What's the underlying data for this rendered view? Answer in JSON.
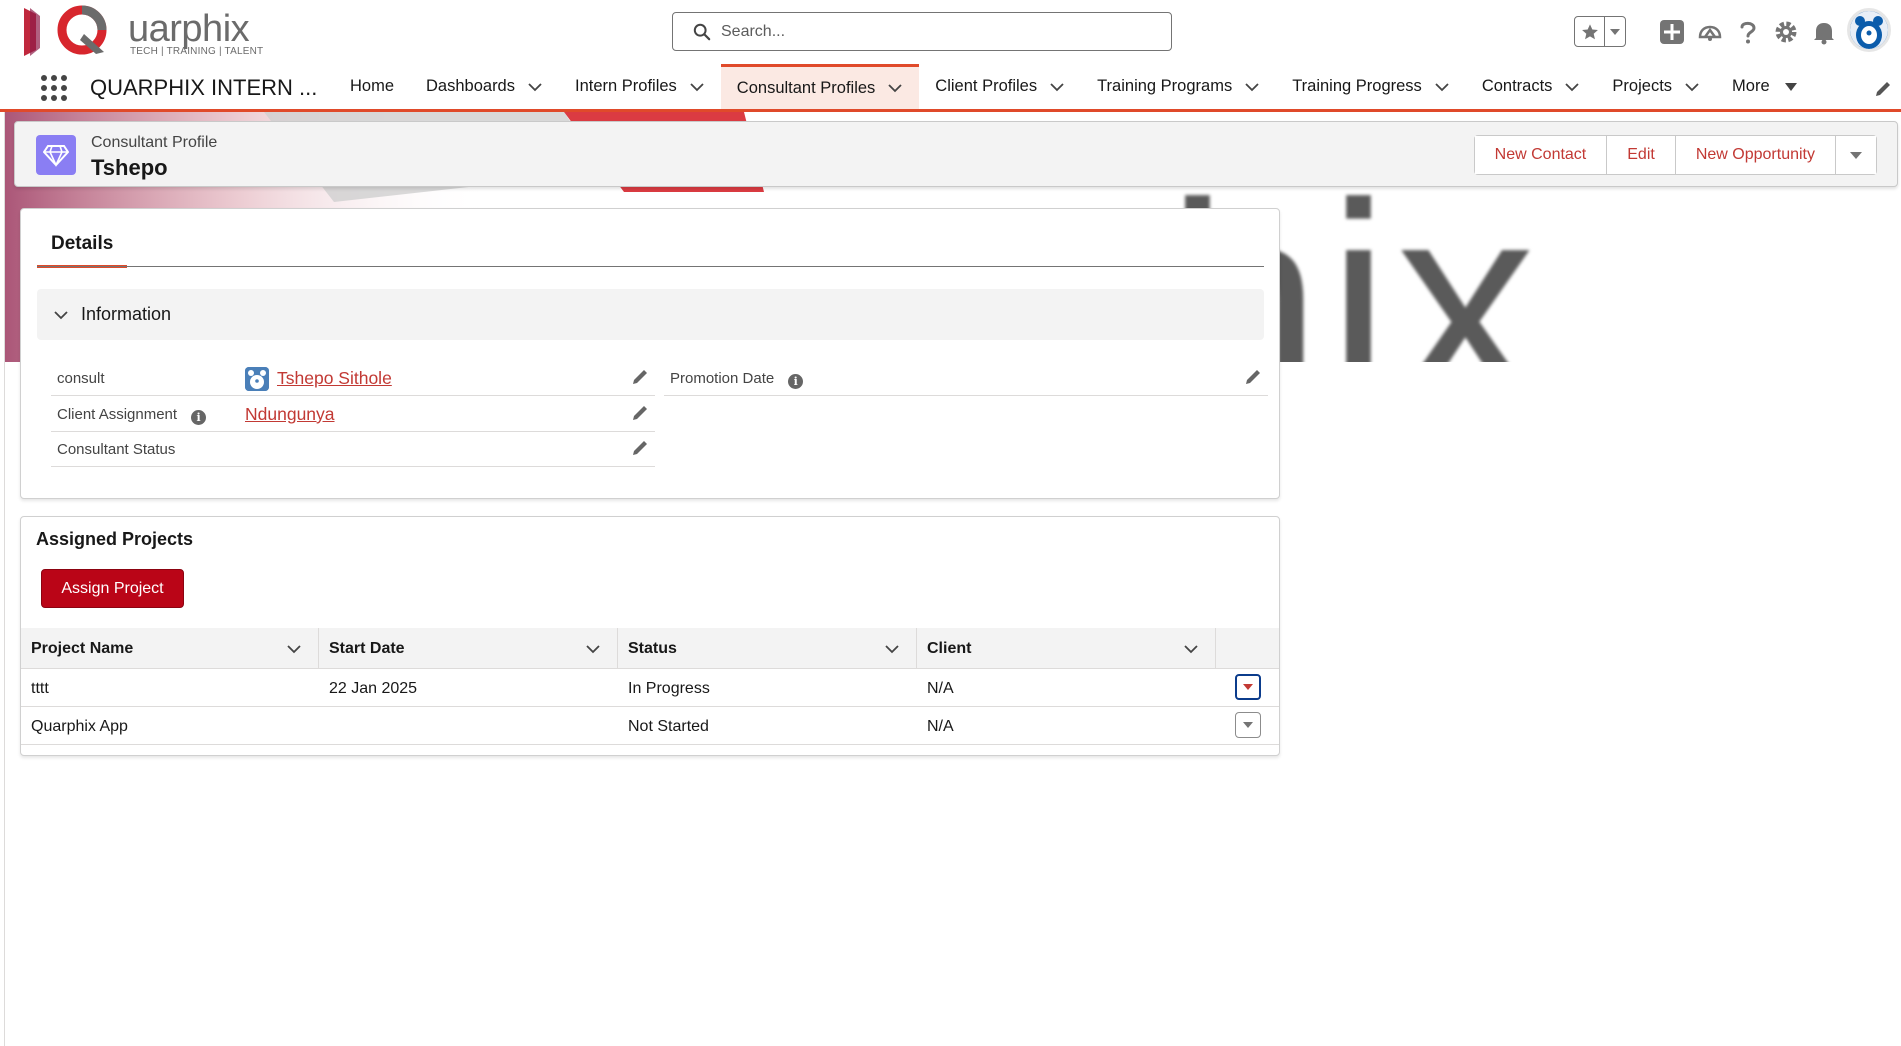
{
  "header": {
    "logo_word": "uarphix",
    "logo_tagline": "TECH | TRAINING | TALENT",
    "search_placeholder": "Search..."
  },
  "nav": {
    "app_name": "QUARPHIX INTERN ...",
    "items": [
      {
        "label": "Home",
        "has_menu": false
      },
      {
        "label": "Dashboards",
        "has_menu": true
      },
      {
        "label": "Intern Profiles",
        "has_menu": true
      },
      {
        "label": "Consultant Profiles",
        "has_menu": true,
        "active": true
      },
      {
        "label": "Client Profiles",
        "has_menu": true
      },
      {
        "label": "Training Programs",
        "has_menu": true
      },
      {
        "label": "Training Progress",
        "has_menu": true
      },
      {
        "label": "Contracts",
        "has_menu": true
      },
      {
        "label": "Projects",
        "has_menu": true
      },
      {
        "label": "More",
        "has_menu": true
      }
    ]
  },
  "banner": {
    "text": "phix"
  },
  "record": {
    "type": "Consultant Profile",
    "title": "Tshepo",
    "actions": [
      "New Contact",
      "Edit",
      "New Opportunity"
    ]
  },
  "details": {
    "tab": "Details",
    "section": "Information",
    "fields": {
      "consult_label": "consult",
      "consult_value": "Tshepo Sithole",
      "client_assignment_label": "Client Assignment",
      "client_assignment_value": "Ndungunya",
      "consultant_status_label": "Consultant Status",
      "promotion_date_label": "Promotion Date"
    }
  },
  "projects": {
    "title": "Assigned Projects",
    "assign_button": "Assign Project",
    "columns": [
      "Project Name",
      "Start Date",
      "Status",
      "Client"
    ],
    "rows": [
      [
        "tttt",
        "22 Jan 2025",
        "In Progress",
        "N/A"
      ],
      [
        "Quarphix App",
        "",
        "Not Started",
        "N/A"
      ]
    ]
  },
  "colors": {
    "brand_accent": "#e04a2a",
    "link": "#c23934",
    "primary_button": "#ba0517",
    "record_icon": "#8a7ef3"
  }
}
